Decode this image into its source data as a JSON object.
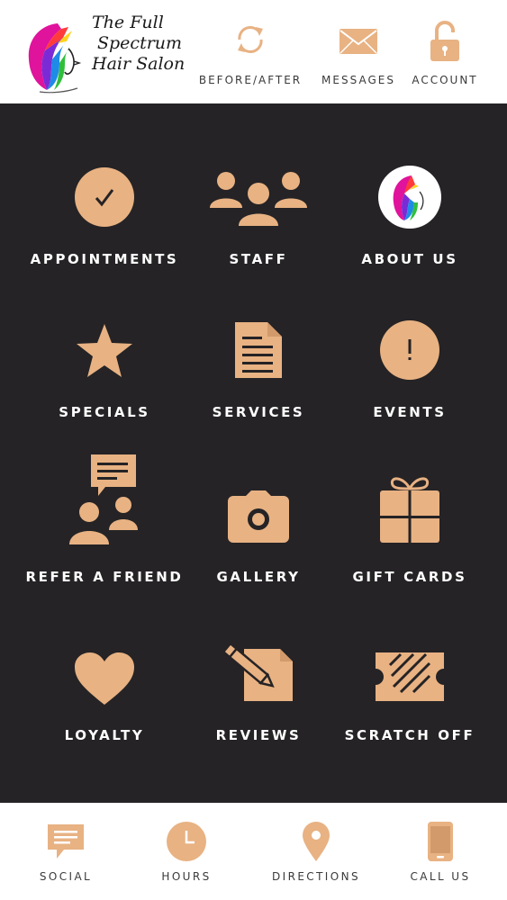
{
  "brand": {
    "line1": "The Full",
    "line2": "Spectrum",
    "line3": "Hair Salon"
  },
  "colors": {
    "accent": "#e8b283",
    "background": "#252325",
    "label": "#ffffff"
  },
  "header_nav": [
    {
      "label": "BEFORE/AFTER",
      "icon": "refresh-icon"
    },
    {
      "label": "MESSAGES",
      "icon": "envelope-icon"
    },
    {
      "label": "ACCOUNT",
      "icon": "lock-icon"
    }
  ],
  "tiles": [
    {
      "label": "APPOINTMENTS",
      "icon": "checkmark-circle-icon"
    },
    {
      "label": "STAFF",
      "icon": "people-group-icon"
    },
    {
      "label": "ABOUT US",
      "icon": "salon-logo-icon"
    },
    {
      "label": "SPECIALS",
      "icon": "star-icon"
    },
    {
      "label": "SERVICES",
      "icon": "document-icon"
    },
    {
      "label": "EVENTS",
      "icon": "exclamation-circle-icon"
    },
    {
      "label": "REFER A FRIEND",
      "icon": "chat-people-icon"
    },
    {
      "label": "GALLERY",
      "icon": "camera-icon"
    },
    {
      "label": "GIFT CARDS",
      "icon": "gift-icon"
    },
    {
      "label": "LOYALTY",
      "icon": "heart-icon"
    },
    {
      "label": "REVIEWS",
      "icon": "pencil-document-icon"
    },
    {
      "label": "SCRATCH OFF",
      "icon": "ticket-icon"
    }
  ],
  "footer_nav": [
    {
      "label": "SOCIAL",
      "icon": "speech-bubble-icon"
    },
    {
      "label": "HOURS",
      "icon": "clock-icon"
    },
    {
      "label": "DIRECTIONS",
      "icon": "map-pin-icon"
    },
    {
      "label": "CALL US",
      "icon": "phone-icon"
    }
  ]
}
